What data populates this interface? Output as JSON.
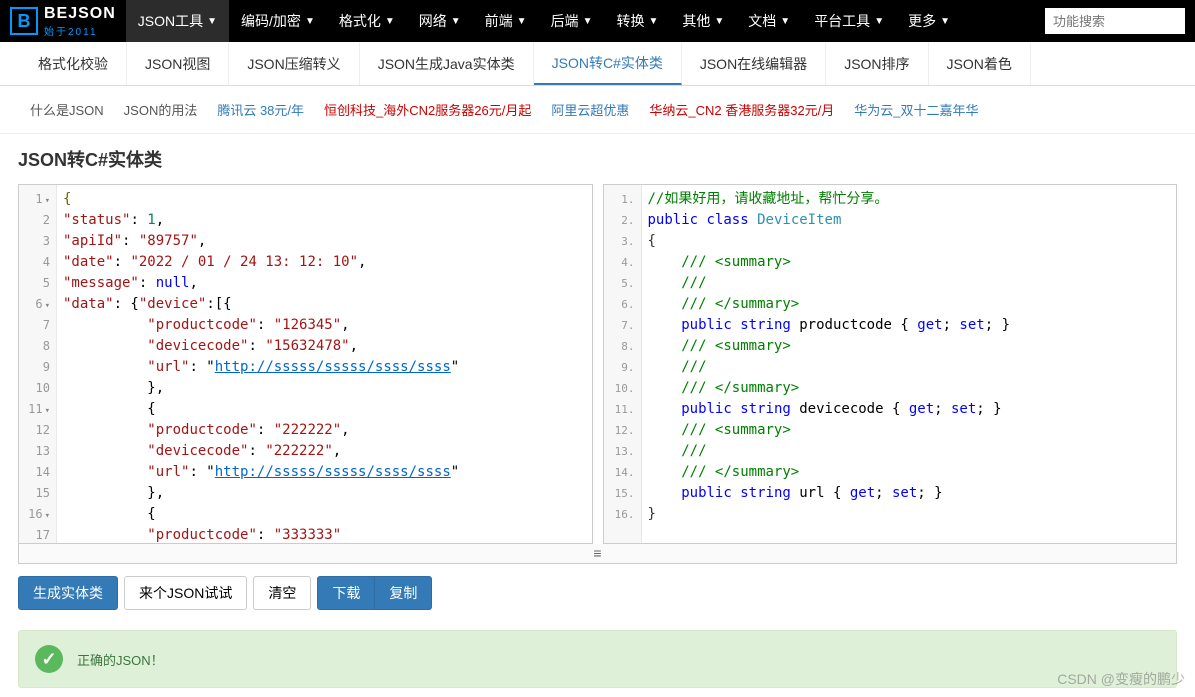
{
  "logo": {
    "icon": "B",
    "text": "BEJSON",
    "sub": "始于2011"
  },
  "topnav": [
    {
      "label": "JSON工具",
      "active": true
    },
    {
      "label": "编码/加密"
    },
    {
      "label": "格式化"
    },
    {
      "label": "网络"
    },
    {
      "label": "前端"
    },
    {
      "label": "后端"
    },
    {
      "label": "转换"
    },
    {
      "label": "其他"
    },
    {
      "label": "文档"
    },
    {
      "label": "平台工具"
    },
    {
      "label": "更多"
    }
  ],
  "search": {
    "placeholder": "功能搜索"
  },
  "subnav": [
    {
      "label": "格式化校验"
    },
    {
      "label": "JSON视图"
    },
    {
      "label": "JSON压缩转义"
    },
    {
      "label": "JSON生成Java实体类"
    },
    {
      "label": "JSON转C#实体类",
      "active": true
    },
    {
      "label": "JSON在线编辑器"
    },
    {
      "label": "JSON排序"
    },
    {
      "label": "JSON着色"
    }
  ],
  "linkbar": [
    {
      "label": "什么是JSON",
      "cls": "lk-gray"
    },
    {
      "label": "JSON的用法",
      "cls": "lk-gray"
    },
    {
      "label": "腾讯云 38元/年",
      "cls": "lk-blue"
    },
    {
      "label": "恒创科技_海外CN2服务器26元/月起",
      "cls": "lk-red"
    },
    {
      "label": "阿里云超优惠",
      "cls": "lk-blue"
    },
    {
      "label": "华纳云_CN2 香港服务器32元/月",
      "cls": "lk-red"
    },
    {
      "label": "华为云_双十二嘉年华",
      "cls": "lk-blue"
    }
  ],
  "page_title": "JSON转C#实体类",
  "left_editor": {
    "lines": [
      {
        "n": "1",
        "fold": true,
        "tokens": [
          {
            "t": "{",
            "c": "tok-brace"
          }
        ]
      },
      {
        "n": "2",
        "tokens": [
          {
            "t": "\"status\"",
            "c": "tok-key"
          },
          {
            "t": ": "
          },
          {
            "t": "1",
            "c": "tok-num"
          },
          {
            "t": ","
          }
        ]
      },
      {
        "n": "3",
        "tokens": [
          {
            "t": "\"apiId\"",
            "c": "tok-key"
          },
          {
            "t": ": "
          },
          {
            "t": "\"89757\"",
            "c": "tok-str"
          },
          {
            "t": ","
          }
        ]
      },
      {
        "n": "4",
        "tokens": [
          {
            "t": "\"date\"",
            "c": "tok-key"
          },
          {
            "t": ": "
          },
          {
            "t": "\"2022 / 01 / 24 13: 12: 10\"",
            "c": "tok-str"
          },
          {
            "t": ","
          }
        ]
      },
      {
        "n": "5",
        "tokens": [
          {
            "t": "\"message\"",
            "c": "tok-key"
          },
          {
            "t": ": "
          },
          {
            "t": "null",
            "c": "tok-null"
          },
          {
            "t": ","
          }
        ]
      },
      {
        "n": "6",
        "fold": true,
        "tokens": [
          {
            "t": "\"data\"",
            "c": "tok-key"
          },
          {
            "t": ": {"
          },
          {
            "t": "\"device\"",
            "c": "tok-key"
          },
          {
            "t": ":[{"
          }
        ]
      },
      {
        "n": "7",
        "tokens": [
          {
            "t": "          "
          },
          {
            "t": "\"productcode\"",
            "c": "tok-key"
          },
          {
            "t": ": "
          },
          {
            "t": "\"126345\"",
            "c": "tok-str"
          },
          {
            "t": ","
          }
        ]
      },
      {
        "n": "8",
        "tokens": [
          {
            "t": "          "
          },
          {
            "t": "\"devicecode\"",
            "c": "tok-key"
          },
          {
            "t": ": "
          },
          {
            "t": "\"15632478\"",
            "c": "tok-str"
          },
          {
            "t": ","
          }
        ]
      },
      {
        "n": "9",
        "tokens": [
          {
            "t": "          "
          },
          {
            "t": "\"url\"",
            "c": "tok-key"
          },
          {
            "t": ": \""
          },
          {
            "t": "http://sssss/sssss/ssss/ssss",
            "c": "tok-url"
          },
          {
            "t": "\""
          }
        ]
      },
      {
        "n": "10",
        "tokens": [
          {
            "t": "          },"
          }
        ]
      },
      {
        "n": "11",
        "fold": true,
        "tokens": [
          {
            "t": "          {"
          }
        ]
      },
      {
        "n": "12",
        "tokens": [
          {
            "t": "          "
          },
          {
            "t": "\"productcode\"",
            "c": "tok-key"
          },
          {
            "t": ": "
          },
          {
            "t": "\"222222\"",
            "c": "tok-str"
          },
          {
            "t": ","
          }
        ]
      },
      {
        "n": "13",
        "tokens": [
          {
            "t": "          "
          },
          {
            "t": "\"devicecode\"",
            "c": "tok-key"
          },
          {
            "t": ": "
          },
          {
            "t": "\"222222\"",
            "c": "tok-str"
          },
          {
            "t": ","
          }
        ]
      },
      {
        "n": "14",
        "tokens": [
          {
            "t": "          "
          },
          {
            "t": "\"url\"",
            "c": "tok-key"
          },
          {
            "t": ": \""
          },
          {
            "t": "http://sssss/sssss/ssss/ssss",
            "c": "tok-url"
          },
          {
            "t": "\""
          }
        ]
      },
      {
        "n": "15",
        "tokens": [
          {
            "t": "          },"
          }
        ]
      },
      {
        "n": "16",
        "fold": true,
        "tokens": [
          {
            "t": "          {"
          }
        ]
      },
      {
        "n": "17",
        "tokens": [
          {
            "t": "          "
          },
          {
            "t": "\"productcode\"",
            "c": "tok-key"
          },
          {
            "t": ": "
          },
          {
            "t": "\"333333\"",
            "c": "tok-str"
          }
        ]
      }
    ]
  },
  "right_editor": {
    "lines": [
      {
        "n": "1.",
        "tokens": [
          {
            "t": "//如果好用，请收藏地址，帮忙分享。",
            "c": "tok-comment"
          }
        ]
      },
      {
        "n": "2.",
        "tokens": [
          {
            "t": "public",
            "c": "tok-kw"
          },
          {
            "t": " "
          },
          {
            "t": "class",
            "c": "tok-kw"
          },
          {
            "t": " "
          },
          {
            "t": "DeviceItem",
            "c": "tok-type"
          }
        ]
      },
      {
        "n": "3.",
        "tokens": [
          {
            "t": "{",
            "c": "tok-punc"
          }
        ]
      },
      {
        "n": "4.",
        "tokens": [
          {
            "t": "    /// <summary>",
            "c": "tok-comment"
          }
        ]
      },
      {
        "n": "5.",
        "tokens": [
          {
            "t": "    ///",
            "c": "tok-comment"
          }
        ]
      },
      {
        "n": "6.",
        "tokens": [
          {
            "t": "    /// </summary>",
            "c": "tok-comment"
          }
        ]
      },
      {
        "n": "7.",
        "tokens": [
          {
            "t": "    "
          },
          {
            "t": "public",
            "c": "tok-kw"
          },
          {
            "t": " "
          },
          {
            "t": "string",
            "c": "tok-kw"
          },
          {
            "t": " "
          },
          {
            "t": "productcode",
            "c": "tok-ident"
          },
          {
            "t": " { "
          },
          {
            "t": "get",
            "c": "tok-kw"
          },
          {
            "t": "; "
          },
          {
            "t": "set",
            "c": "tok-kw"
          },
          {
            "t": "; }"
          }
        ]
      },
      {
        "n": "8.",
        "tokens": [
          {
            "t": "    /// <summary>",
            "c": "tok-comment"
          }
        ]
      },
      {
        "n": "9.",
        "tokens": [
          {
            "t": "    ///",
            "c": "tok-comment"
          }
        ]
      },
      {
        "n": "10.",
        "tokens": [
          {
            "t": "    /// </summary>",
            "c": "tok-comment"
          }
        ]
      },
      {
        "n": "11.",
        "tokens": [
          {
            "t": "    "
          },
          {
            "t": "public",
            "c": "tok-kw"
          },
          {
            "t": " "
          },
          {
            "t": "string",
            "c": "tok-kw"
          },
          {
            "t": " "
          },
          {
            "t": "devicecode",
            "c": "tok-ident"
          },
          {
            "t": " { "
          },
          {
            "t": "get",
            "c": "tok-kw"
          },
          {
            "t": "; "
          },
          {
            "t": "set",
            "c": "tok-kw"
          },
          {
            "t": "; }"
          }
        ]
      },
      {
        "n": "12.",
        "tokens": [
          {
            "t": "    /// <summary>",
            "c": "tok-comment"
          }
        ]
      },
      {
        "n": "13.",
        "tokens": [
          {
            "t": "    ///",
            "c": "tok-comment"
          }
        ]
      },
      {
        "n": "14.",
        "tokens": [
          {
            "t": "    /// </summary>",
            "c": "tok-comment"
          }
        ]
      },
      {
        "n": "15.",
        "tokens": [
          {
            "t": "    "
          },
          {
            "t": "public",
            "c": "tok-kw"
          },
          {
            "t": " "
          },
          {
            "t": "string",
            "c": "tok-kw"
          },
          {
            "t": " "
          },
          {
            "t": "url",
            "c": "tok-ident"
          },
          {
            "t": " { "
          },
          {
            "t": "get",
            "c": "tok-kw"
          },
          {
            "t": "; "
          },
          {
            "t": "set",
            "c": "tok-kw"
          },
          {
            "t": "; }"
          }
        ]
      },
      {
        "n": "16.",
        "tokens": [
          {
            "t": "}",
            "c": "tok-punc"
          }
        ]
      }
    ]
  },
  "drag_handle": "≡",
  "buttons": {
    "generate": "生成实体类",
    "sample": "来个JSON试试",
    "clear": "清空",
    "download": "下载",
    "copy": "复制"
  },
  "alert": {
    "icon": "✓",
    "text": "正确的JSON！"
  },
  "watermark": "CSDN @变瘦的鹏少"
}
